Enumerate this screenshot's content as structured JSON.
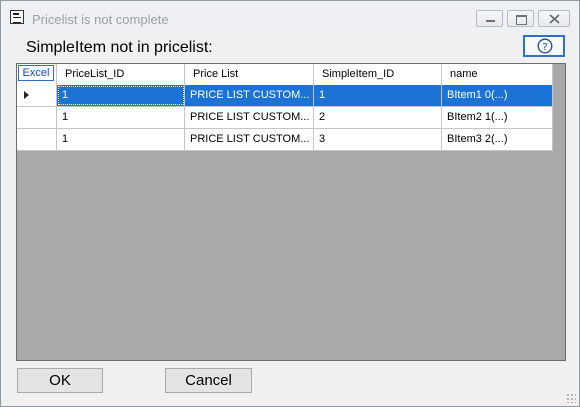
{
  "window": {
    "title": "Pricelist is not complete"
  },
  "caption": "SimpleItem not in pricelist:",
  "grid": {
    "excel_label": "Excel",
    "columns": [
      "PriceList_ID",
      "Price List",
      "SimpleItem_ID",
      "name"
    ],
    "rows": [
      [
        "1",
        "PRICE LIST CUSTOM...",
        "1",
        "BItem1    0(...)"
      ],
      [
        "1",
        "PRICE LIST CUSTOM...",
        "2",
        "BItem2    1(...)"
      ],
      [
        "1",
        "PRICE LIST CUSTOM...",
        "3",
        "BItem3    2(...)"
      ]
    ],
    "selected_row": 0
  },
  "buttons": {
    "ok": "OK",
    "cancel": "Cancel"
  },
  "colors": {
    "selection": "#1c73d6",
    "grid_background": "#a9a9a9",
    "accent": "#2f6fd0"
  }
}
